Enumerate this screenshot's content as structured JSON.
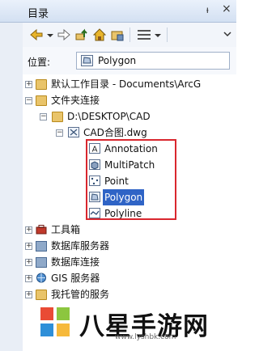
{
  "window": {
    "title": "目录",
    "pin": "ᵼ",
    "close": "×"
  },
  "location": {
    "label": "位置:",
    "value": "Polygon"
  },
  "tree": {
    "root": "默认工作目录 - Documents\\ArcG",
    "folder_connections": "文件夹连接",
    "desktop_path": "D:\\DESKTOP\\CAD",
    "dwg_file": "CAD合图.dwg",
    "layers": [
      "Annotation",
      "MultiPatch",
      "Point",
      "Polygon",
      "Polyline"
    ],
    "toolbox": "工具箱",
    "db_servers": "数据库服务器",
    "db_connections": "数据库连接",
    "gis_servers": "GIS 服务器",
    "hosted": "我托管的服务"
  },
  "watermark": {
    "site_cn": "八星手游网",
    "url": "www.lyshbk.com"
  },
  "colors": {
    "selection": "#2f64c6",
    "highlight_box": "#d9272e"
  }
}
